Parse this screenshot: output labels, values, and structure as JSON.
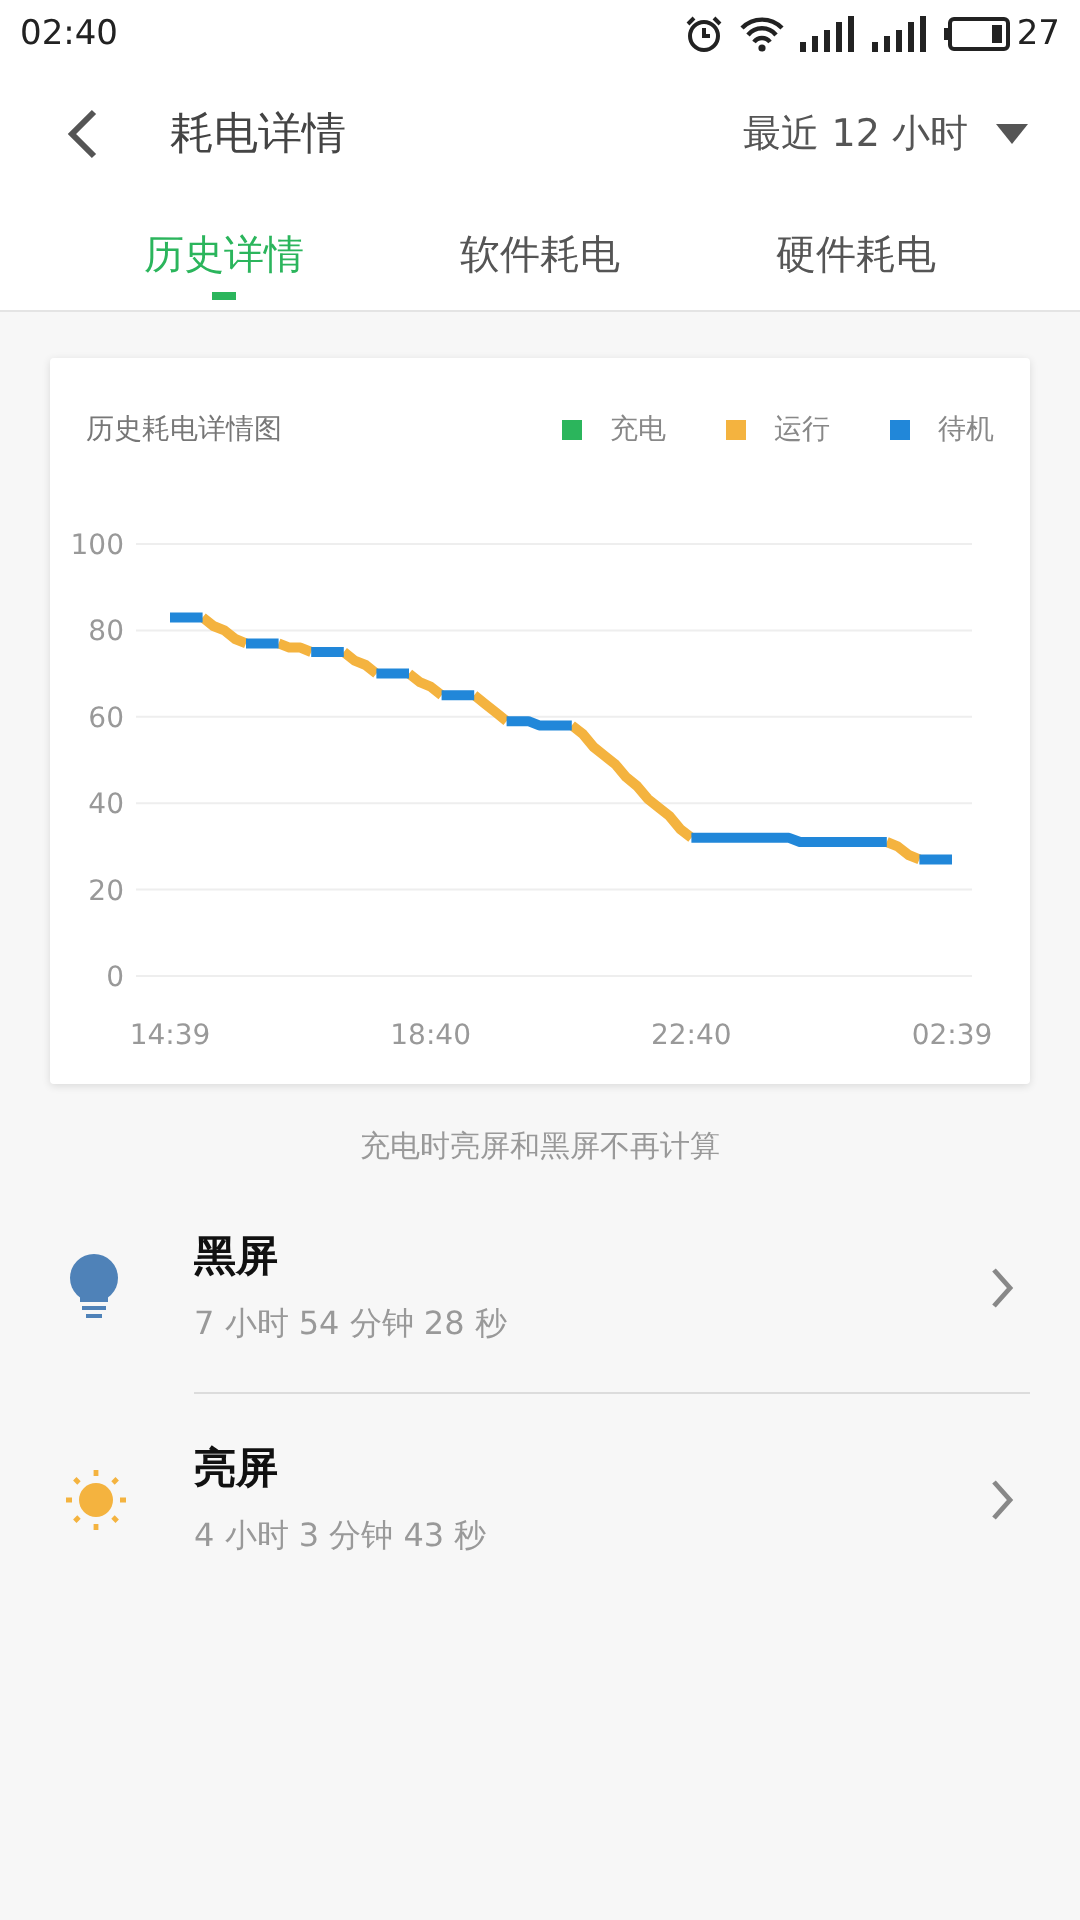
{
  "status_bar": {
    "time": "02:40",
    "battery_text": "27"
  },
  "header": {
    "title": "耗电详情",
    "range": "最近 12 小时"
  },
  "tabs": [
    {
      "label": "历史详情",
      "selected": true
    },
    {
      "label": "软件耗电",
      "selected": false
    },
    {
      "label": "硬件耗电",
      "selected": false
    }
  ],
  "chart_card": {
    "title": "历史耗电详情图",
    "chart_data": {
      "type": "line",
      "categories": [
        "14:39",
        null,
        null,
        null,
        null,
        null,
        null,
        null,
        null,
        null,
        null,
        null,
        null,
        null,
        null,
        null,
        null,
        null,
        null,
        null,
        null,
        null,
        null,
        null,
        "18:40",
        null,
        null,
        null,
        null,
        null,
        null,
        null,
        null,
        null,
        null,
        null,
        null,
        null,
        null,
        null,
        null,
        null,
        null,
        null,
        null,
        null,
        null,
        null,
        "22:40",
        null,
        null,
        null,
        null,
        null,
        null,
        null,
        null,
        null,
        null,
        null,
        null,
        null,
        null,
        null,
        null,
        null,
        null,
        null,
        null,
        null,
        null,
        null,
        "02:39"
      ],
      "series": [
        {
          "name": "充电",
          "color": "#2bb55c",
          "values": [
            null,
            null,
            null,
            null,
            null,
            null,
            null,
            null,
            null,
            null,
            null,
            null,
            null,
            null,
            null,
            null,
            null,
            null,
            null,
            null,
            null,
            null,
            null,
            null,
            null,
            null,
            null,
            null,
            null,
            null,
            null,
            null,
            null,
            null,
            null,
            null,
            null,
            null,
            null,
            null,
            null,
            null,
            null,
            null,
            null,
            null,
            null,
            null,
            null,
            null,
            null,
            null,
            null,
            null,
            null,
            null,
            null,
            null,
            null,
            null,
            null,
            null,
            null,
            null,
            null,
            null,
            null,
            null,
            null,
            null,
            null,
            null,
            null
          ]
        },
        {
          "name": "运行",
          "color": "#f4b33f",
          "values": [
            null,
            null,
            null,
            83,
            81,
            80,
            78,
            77,
            null,
            null,
            77,
            76,
            76,
            75,
            null,
            null,
            75,
            73,
            72,
            70,
            null,
            null,
            70,
            68,
            67,
            65,
            null,
            null,
            65,
            63,
            61,
            59,
            null,
            null,
            null,
            null,
            null,
            58,
            56,
            53,
            51,
            49,
            46,
            44,
            41,
            39,
            37,
            34,
            32,
            null,
            null,
            null,
            null,
            null,
            null,
            null,
            null,
            null,
            null,
            null,
            null,
            null,
            null,
            null,
            null,
            null,
            31,
            30,
            28,
            27,
            null,
            null,
            null
          ]
        },
        {
          "name": "待机",
          "color": "#2187d9",
          "values": [
            83,
            83,
            83,
            83,
            null,
            null,
            null,
            77,
            77,
            77,
            77,
            null,
            null,
            75,
            75,
            75,
            75,
            null,
            null,
            70,
            70,
            70,
            70,
            null,
            null,
            65,
            65,
            65,
            65,
            null,
            null,
            59,
            59,
            59,
            58,
            58,
            58,
            58,
            null,
            null,
            null,
            null,
            null,
            null,
            null,
            null,
            null,
            null,
            32,
            32,
            32,
            32,
            32,
            32,
            32,
            32,
            32,
            32,
            31,
            31,
            31,
            31,
            31,
            31,
            31,
            31,
            31,
            null,
            null,
            27,
            27,
            27,
            27
          ]
        }
      ],
      "ylim": [
        0,
        100
      ],
      "grid": true,
      "yticks": [
        0,
        20,
        40,
        60,
        80,
        100
      ]
    }
  },
  "note": "充电时亮屏和黑屏不再计算",
  "rows": [
    {
      "kind": "bulb",
      "title": "黑屏",
      "duration": "7 小时 54 分钟 28 秒"
    },
    {
      "kind": "sun",
      "title": "亮屏",
      "duration": "4 小时 3 分钟 43 秒"
    }
  ]
}
